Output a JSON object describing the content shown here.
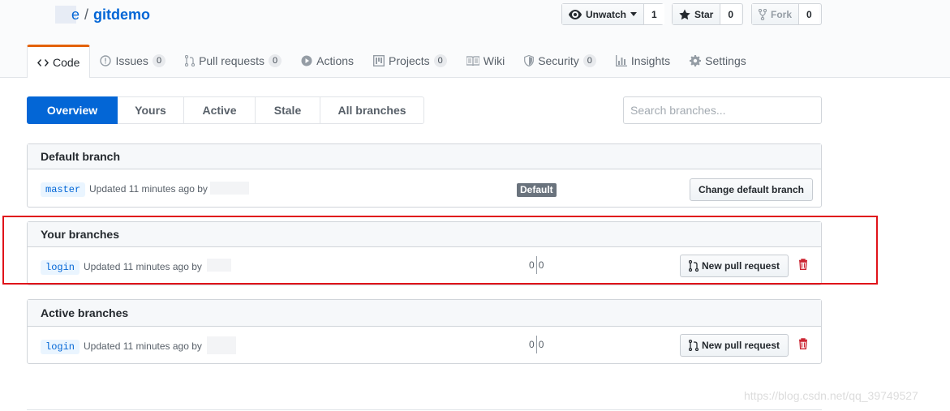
{
  "repo": {
    "owner_visible": "e",
    "separator": "/",
    "name": "gitdemo"
  },
  "header_buttons": {
    "watch": {
      "label": "Unwatch",
      "count": "1"
    },
    "star": {
      "label": "Star",
      "count": "0"
    },
    "fork": {
      "label": "Fork",
      "count": "0"
    }
  },
  "tabs": [
    {
      "label": "Code",
      "count": "",
      "icon": "code-icon"
    },
    {
      "label": "Issues",
      "count": "0",
      "icon": "issue-icon"
    },
    {
      "label": "Pull requests",
      "count": "0",
      "icon": "pull-request-icon"
    },
    {
      "label": "Actions",
      "count": "",
      "icon": "play-icon"
    },
    {
      "label": "Projects",
      "count": "0",
      "icon": "project-icon"
    },
    {
      "label": "Wiki",
      "count": "",
      "icon": "book-icon"
    },
    {
      "label": "Security",
      "count": "0",
      "icon": "shield-icon"
    },
    {
      "label": "Insights",
      "count": "",
      "icon": "graph-icon"
    },
    {
      "label": "Settings",
      "count": "",
      "icon": "gear-icon"
    }
  ],
  "subnav": [
    "Overview",
    "Yours",
    "Active",
    "Stale",
    "All branches"
  ],
  "search": {
    "placeholder": "Search branches..."
  },
  "default_branch": {
    "title": "Default branch",
    "branch": "master",
    "updated": "Updated 11 minutes ago by",
    "badge": "Default",
    "button": "Change default branch"
  },
  "your_branches": {
    "title": "Your branches",
    "branch": "login",
    "updated": "Updated 11 minutes ago by",
    "behind": "0",
    "ahead": "0",
    "button": "New pull request"
  },
  "active_branches": {
    "title": "Active branches",
    "branch": "login",
    "updated": "Updated 11 minutes ago by",
    "behind": "0",
    "ahead": "0",
    "button": "New pull request"
  },
  "watermark": "https://blog.csdn.net/qq_39749527",
  "colors": {
    "accent": "#0366d6",
    "selected_tab_border": "#e36209",
    "highlight": "#e0131a",
    "delete": "#cb2431"
  }
}
